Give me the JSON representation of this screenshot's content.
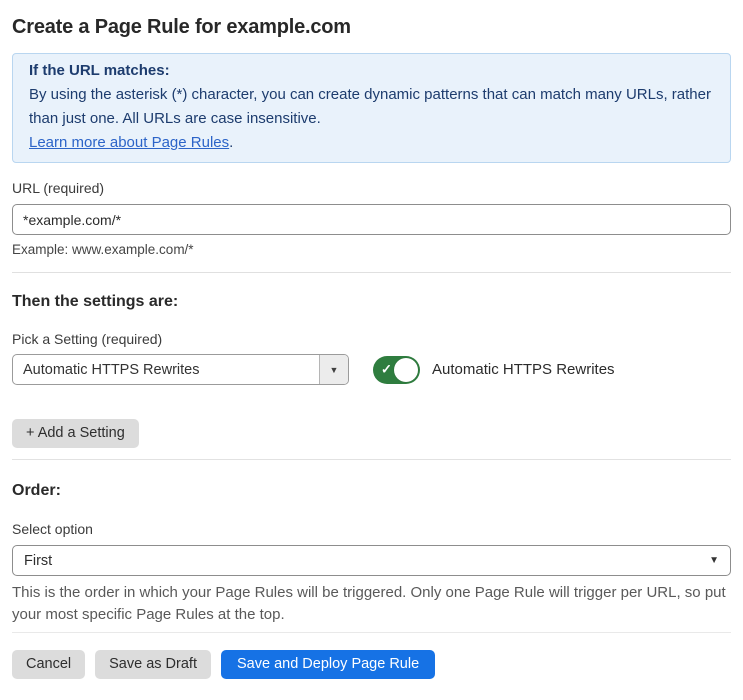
{
  "page": {
    "title": "Create a Page Rule for example.com"
  },
  "info_box": {
    "heading": "If the URL matches:",
    "body": "By using the asterisk (*) character, you can create dynamic patterns that can match many URLs, rather than just one. All URLs are case insensitive.",
    "link_label": "Learn more about Page Rules",
    "link_suffix": "."
  },
  "url_field": {
    "label": "URL (required)",
    "value": "*example.com/*",
    "helper": "Example: www.example.com/*"
  },
  "settings_section": {
    "heading": "Then the settings are:",
    "picker_label": "Pick a Setting (required)",
    "picker_value": "Automatic HTTPS Rewrites",
    "toggle_label": "Automatic HTTPS Rewrites",
    "toggle_state": "on",
    "add_setting_label": "+ Add a Setting"
  },
  "order_section": {
    "heading": "Order:",
    "select_label": "Select option",
    "select_value": "First",
    "helper": "This is the order in which your Page Rules will be triggered. Only one Page Rule will trigger per URL, so put your most specific Page Rules at the top."
  },
  "footer": {
    "cancel_label": "Cancel",
    "save_draft_label": "Save as Draft",
    "save_deploy_label": "Save and Deploy Page Rule"
  },
  "icons": {
    "dropdown_arrow": "▼",
    "check": "✓"
  },
  "colors": {
    "info_bg": "#e9f2fb",
    "info_border": "#b9d6f0",
    "info_text": "#1d3c6e",
    "link_blue": "#2c64c8",
    "toggle_green": "#2f7d3f",
    "primary_blue": "#1672e5",
    "button_gray": "#dcdcdc"
  }
}
